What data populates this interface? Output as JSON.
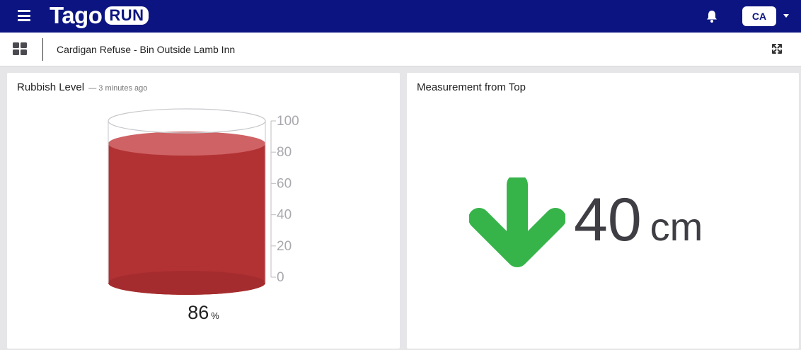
{
  "app": {
    "logo_text": "Tago",
    "logo_badge": "RUN",
    "user_initials": "CA"
  },
  "colors": {
    "topbar": "#0b1480",
    "bin_fill": "#b23234",
    "bin_top": "#cf6264",
    "arrow": "#36b44a"
  },
  "icons": {
    "menu": "menu-icon",
    "notifications": "bell-icon",
    "dashboards": "grid-icon",
    "fullscreen": "expand-icon",
    "account_menu": "caret-down-icon"
  },
  "subheader": {
    "dashboard_title": "Cardigan Refuse - Bin Outside Lamb Inn"
  },
  "widgets": {
    "level": {
      "title": "Rubbish Level",
      "updated": "— 3 minutes ago",
      "value": "86",
      "unit": "%",
      "fill_fraction": 0.86,
      "scale_ticks": [
        "100",
        "80",
        "60",
        "40",
        "20",
        "0"
      ]
    },
    "measurement": {
      "title": "Measurement from Top",
      "value": "40",
      "unit": "cm",
      "direction": "down"
    }
  }
}
